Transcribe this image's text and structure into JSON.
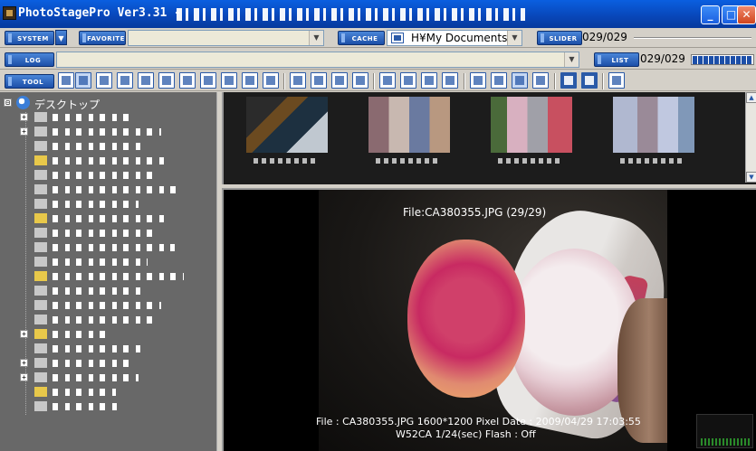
{
  "window": {
    "title": "PhotoStagePro Ver3.31 -",
    "min_label": "_",
    "max_label": "□",
    "close_label": "✕"
  },
  "toolbar_row1": {
    "system_label": "SYSTEM",
    "favorite_label": "FAVORITE",
    "cache_label": "CACHE",
    "path_value": "H¥My Documents",
    "slider_label": "SLIDER",
    "slider_counter": "029/029"
  },
  "toolbar_row2": {
    "log_label": "LOG",
    "list_label": "LIST",
    "list_counter": "029/029"
  },
  "toolbar_row3": {
    "tool_label": "TOOL",
    "icons": [
      "list-view-icon",
      "details-view-icon",
      "thumbnail-view-icon",
      "grid-view-icon",
      "slideshow-icon",
      "zoom-1x-icon",
      "help-icon",
      "edit-icon",
      "rotate-left-icon",
      "rotate-right-icon",
      "flip-icon",
      "frame-icon",
      "check-icon",
      "stop-icon",
      "copy-icon",
      "refresh-icon",
      "calc-icon",
      "compare-icon",
      "split-view-icon",
      "tools-icon",
      "share-icon",
      "panel-icon",
      "four-pane-icon",
      "prev-arrow-icon",
      "next-arrow-icon",
      "mail-icon"
    ]
  },
  "tree": {
    "root_label": "デスクトップ",
    "root_expander": "⊟"
  },
  "viewer": {
    "file_header": "File:CA380355.JPG  (29/29)",
    "info_line1": "File : CA380355.JPG  1600*1200 Pixel  Date : 2009/04/29 17:03:55",
    "info_line2": "W52CA  1/24(sec)                    Flash : Off"
  },
  "colors": {
    "title_bar": "#0846b8",
    "button_blue": "#1c4fa8",
    "tree_bg": "#686868",
    "viewer_bg": "#000000"
  }
}
